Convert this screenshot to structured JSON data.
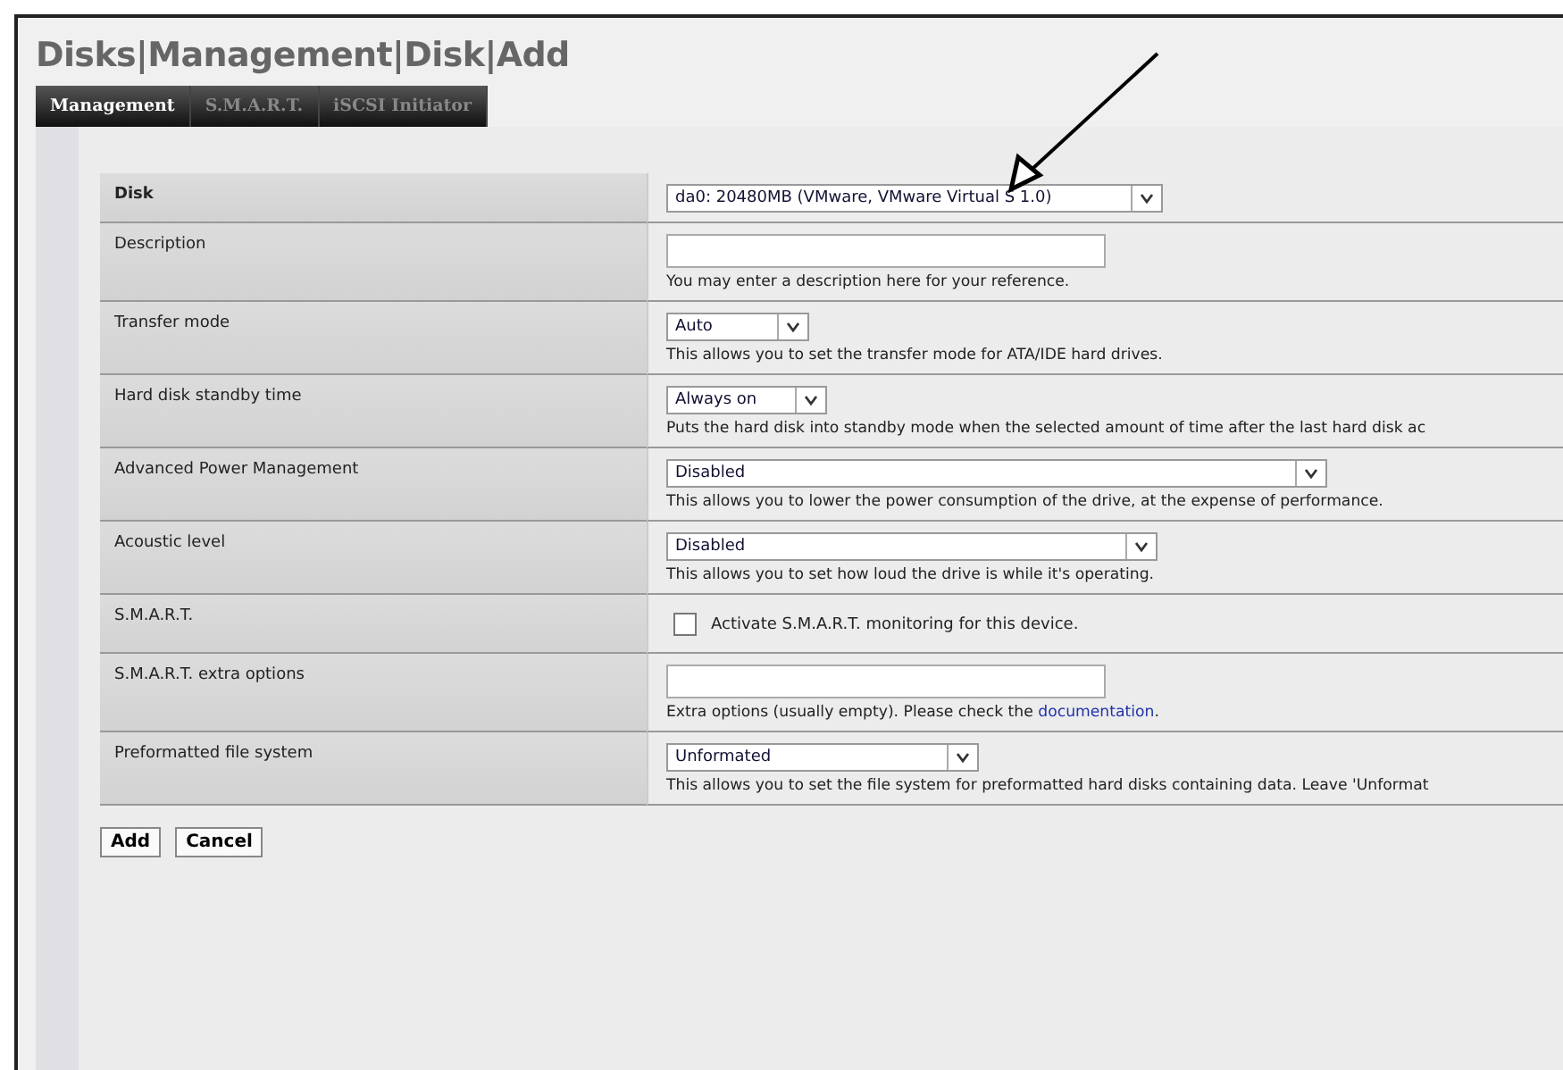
{
  "title": "Disks|Management|Disk|Add",
  "tabs": [
    {
      "label": "Management",
      "selected": true
    },
    {
      "label": "S.M.A.R.T.",
      "selected": false
    },
    {
      "label": "iSCSI Initiator",
      "selected": false
    }
  ],
  "rows": [
    {
      "label": "Disk",
      "kind": "select",
      "value": "da0: 20480MB (VMware, VMware Virtual S 1.0)"
    },
    {
      "label": "Description",
      "kind": "text",
      "hint": "You may enter a description here for your reference."
    },
    {
      "label": "Transfer mode",
      "kind": "select",
      "value": "Auto",
      "hint": "This allows you to set the transfer mode for ATA/IDE hard drives."
    },
    {
      "label": "Hard disk standby time",
      "kind": "select",
      "value": "Always on",
      "hint": "Puts the hard disk into standby mode when the selected amount of time after the last hard disk ac"
    },
    {
      "label": "Advanced Power Management",
      "kind": "select",
      "value": "Disabled",
      "hint": "This allows you to lower the power consumption of the drive, at the expense of performance."
    },
    {
      "label": "Acoustic level",
      "kind": "select",
      "value": "Disabled",
      "hint": "This allows you to set how loud the drive is while it's operating."
    },
    {
      "label": "S.M.A.R.T.",
      "kind": "checkbox",
      "checked": false,
      "text": "Activate S.M.A.R.T. monitoring for this device."
    },
    {
      "label": "S.M.A.R.T. extra options",
      "kind": "text",
      "hint": "Extra options (usually empty). Please check the ",
      "link": "documentation",
      "hint_after": "."
    },
    {
      "label": "Preformatted file system",
      "kind": "select",
      "value": "Unformated",
      "hint": "This allows you to set the file system for preformatted hard disks containing data. Leave 'Unformat"
    }
  ],
  "buttons": [
    "Add",
    "Cancel"
  ]
}
